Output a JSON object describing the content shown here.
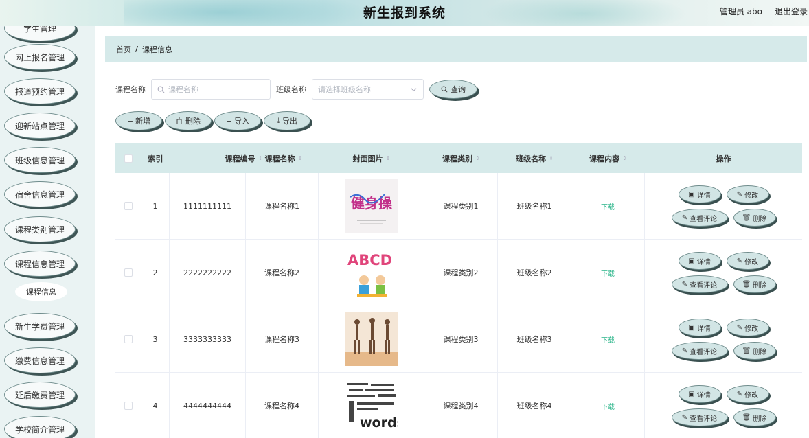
{
  "header": {
    "title": "新生报到系统",
    "user": "管理员 abo",
    "logout": "退出登录"
  },
  "sidebar": {
    "items": [
      {
        "label": "学生管理"
      },
      {
        "label": "网上报名管理"
      },
      {
        "label": "报道预约管理"
      },
      {
        "label": "迎新站点管理"
      },
      {
        "label": "班级信息管理"
      },
      {
        "label": "宿舍信息管理"
      },
      {
        "label": "课程类别管理"
      },
      {
        "label": "课程信息管理"
      },
      {
        "label": "新生学费管理"
      },
      {
        "label": "缴费信息管理"
      },
      {
        "label": "延后缴费管理"
      },
      {
        "label": "学校简介管理"
      }
    ],
    "sub_item": "课程信息"
  },
  "breadcrumb": {
    "home": "首页",
    "sep": "/",
    "current": "课程信息"
  },
  "search": {
    "course_label": "课程名称",
    "course_placeholder": "课程名称",
    "class_label": "班级名称",
    "class_placeholder": "请选择班级名称",
    "query_button": "查询"
  },
  "toolbar": {
    "add": "新增",
    "delete": "删除",
    "import": "导入",
    "export": "导出"
  },
  "table": {
    "headers": [
      "索引",
      "课程编号",
      "课程名称",
      "封面图片",
      "课程类别",
      "班级名称",
      "课程内容",
      "操作"
    ],
    "rows": [
      {
        "index": "1",
        "code": "1111111111",
        "name": "课程名称1",
        "category": "课程类别1",
        "class": "班级名称1",
        "content": "下载",
        "cover_text": "健身操"
      },
      {
        "index": "2",
        "code": "2222222222",
        "name": "课程名称2",
        "category": "课程类别2",
        "class": "班级名称2",
        "content": "下载",
        "cover_text": "ABCD"
      },
      {
        "index": "3",
        "code": "3333333333",
        "name": "课程名称3",
        "category": "课程类别3",
        "class": "班级名称3",
        "content": "下载",
        "cover_text": ""
      },
      {
        "index": "4",
        "code": "4444444444",
        "name": "课程名称4",
        "category": "课程类别4",
        "class": "班级名称4",
        "content": "下载",
        "cover_text": "words"
      }
    ],
    "actions": {
      "detail": "详情",
      "edit": "修改",
      "comments": "查看评论",
      "delete": "删除"
    }
  }
}
